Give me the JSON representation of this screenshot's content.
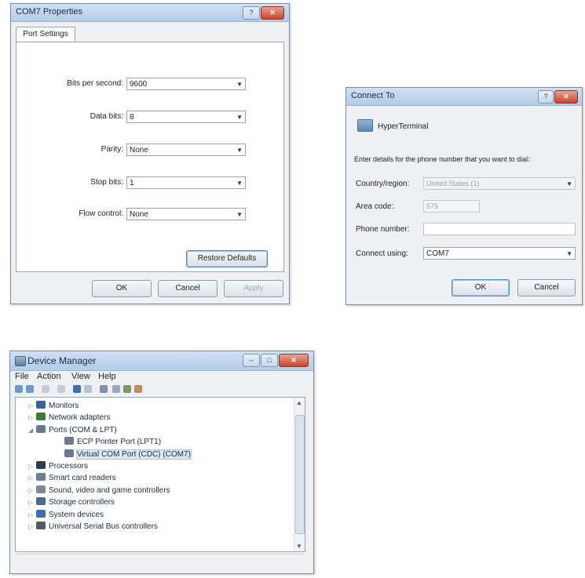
{
  "com_properties": {
    "title": "COM7 Properties",
    "tab": "Port Settings",
    "fields": [
      {
        "label": "Bits per second:",
        "value": "9600"
      },
      {
        "label": "Data bits:",
        "value": "8"
      },
      {
        "label": "Parity:",
        "value": "None"
      },
      {
        "label": "Stop bits:",
        "value": "1"
      },
      {
        "label": "Flow control:",
        "value": "None"
      }
    ],
    "restore_label": "Restore Defaults",
    "ok_label": "OK",
    "cancel_label": "Cancel",
    "apply_label": "Apply"
  },
  "connect_to": {
    "title": "Connect To",
    "app_name": "HyperTerminal",
    "prompt": "Enter details for the phone number that you want to dial:",
    "country_label": "Country/region:",
    "country_value": "United States (1)",
    "area_label": "Area code:",
    "area_value": "575",
    "phone_label": "Phone number:",
    "phone_value": "",
    "connect_label": "Connect using:",
    "connect_value": "COM7",
    "ok_label": "OK",
    "cancel_label": "Cancel"
  },
  "device_manager": {
    "title": "Device Manager",
    "menu": [
      "File",
      "Action",
      "View",
      "Help"
    ],
    "tree": [
      {
        "label": "Monitors",
        "depth": 1,
        "expander": "▷",
        "icon": "monitor-icon",
        "color": "#3a5f9e"
      },
      {
        "label": "Network adapters",
        "depth": 1,
        "expander": "▷",
        "icon": "network-icon",
        "color": "#3b7a3b"
      },
      {
        "label": "Ports (COM & LPT)",
        "depth": 1,
        "expander": "◢",
        "icon": "port-icon",
        "color": "#6b7a8f"
      },
      {
        "label": "ECP Printer Port (LPT1)",
        "depth": 2,
        "expander": "",
        "icon": "port-icon",
        "color": "#6b7a8f"
      },
      {
        "label": "Virtual COM Port (CDC) (COM7)",
        "depth": 2,
        "expander": "",
        "icon": "port-icon",
        "color": "#6b7a8f",
        "selected": true
      },
      {
        "label": "Processors",
        "depth": 1,
        "expander": "▷",
        "icon": "processor-icon",
        "color": "#2f3d52"
      },
      {
        "label": "Smart card readers",
        "depth": 1,
        "expander": "▷",
        "icon": "smart-card-icon",
        "color": "#6d7f93"
      },
      {
        "label": "Sound, video and game controllers",
        "depth": 1,
        "expander": "▷",
        "icon": "sound-icon",
        "color": "#7a8a9c"
      },
      {
        "label": "Storage controllers",
        "depth": 1,
        "expander": "▷",
        "icon": "storage-icon",
        "color": "#4e6a8a"
      },
      {
        "label": "System devices",
        "depth": 1,
        "expander": "▷",
        "icon": "system-icon",
        "color": "#3d6fb0"
      },
      {
        "label": "Universal Serial Bus controllers",
        "depth": 1,
        "expander": "▷",
        "icon": "usb-icon",
        "color": "#4f5a66"
      }
    ]
  }
}
